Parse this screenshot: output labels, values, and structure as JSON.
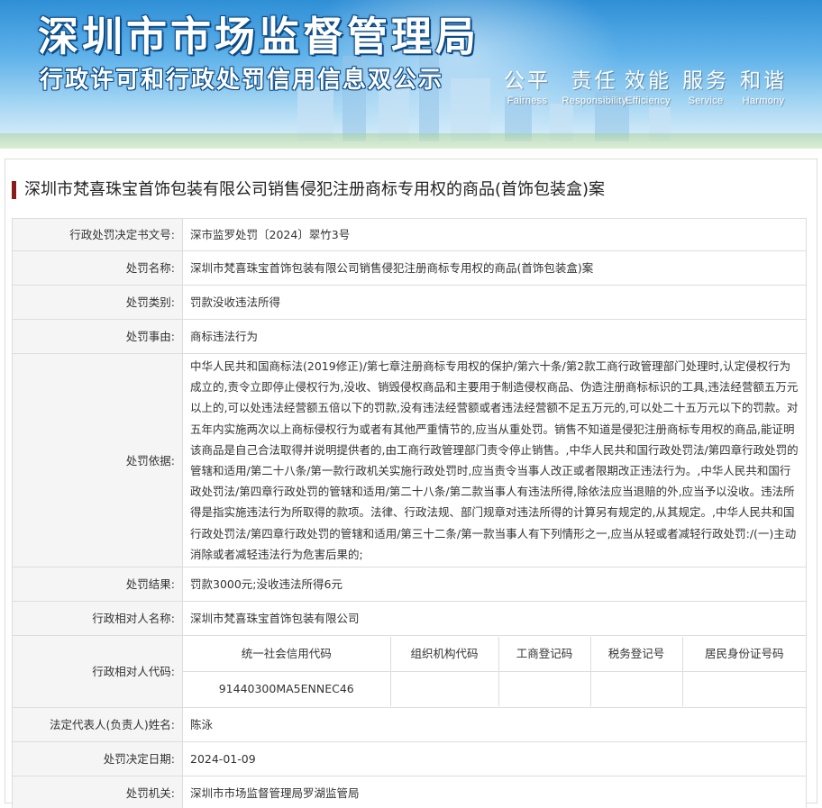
{
  "banner": {
    "title": "深圳市市场监督管理局",
    "subtitle": "行政许可和行政处罚信用信息双公示",
    "slogans": [
      {
        "cn": "公平",
        "en": "Fairness"
      },
      {
        "cn": "责任",
        "en": "Responsibility"
      },
      {
        "cn": "效能",
        "en": "Efficiency"
      },
      {
        "cn": "服务",
        "en": "Service"
      },
      {
        "cn": "和谐",
        "en": "Harmony"
      }
    ]
  },
  "case_title": "深圳市梵喜珠宝首饰包装有限公司销售侵犯注册商标专用权的商品(首饰包装盒)案",
  "details": {
    "decision_no": {
      "label": "行政处罚决定书文号:",
      "value": "深市监罗处罚〔2024〕翠竹3号"
    },
    "penalty_name": {
      "label": "处罚名称:",
      "value": "深圳市梵喜珠宝首饰包装有限公司销售侵犯注册商标专用权的商品(首饰包装盒)案"
    },
    "category": {
      "label": "处罚类别:",
      "value": "罚款没收违法所得"
    },
    "reason": {
      "label": "处罚事由:",
      "value": "商标违法行为"
    },
    "basis": {
      "label": "处罚依据:",
      "value": "中华人民共和国商标法(2019修正)/第七章注册商标专用权的保护/第六十条/第2款工商行政管理部门处理时,认定侵权行为成立的,责令立即停止侵权行为,没收、销毁侵权商品和主要用于制造侵权商品、伪造注册商标标识的工具,违法经营额五万元以上的,可以处违法经营额五倍以下的罚款,没有违法经营额或者违法经营额不足五万元的,可以处二十五万元以下的罚款。对五年内实施两次以上商标侵权行为或者有其他严重情节的,应当从重处罚。销售不知道是侵犯注册商标专用权的商品,能证明该商品是自己合法取得并说明提供者的,由工商行政管理部门责令停止销售。,中华人民共和国行政处罚法/第四章行政处罚的管辖和适用/第二十八条/第一款行政机关实施行政处罚时,应当责令当事人改正或者限期改正违法行为。,中华人民共和国行政处罚法/第四章行政处罚的管辖和适用/第二十八条/第二款当事人有违法所得,除依法应当退赔的外,应当予以没收。违法所得是指实施违法行为所取得的款项。法律、行政法规、部门规章对违法所得的计算另有规定的,从其规定。,中华人民共和国行政处罚法/第四章行政处罚的管辖和适用/第三十二条/第一款当事人有下列情形之一,应当从轻或者减轻行政处罚:/(一)主动消除或者减轻违法行为危害后果的;"
    },
    "result": {
      "label": "处罚结果:",
      "value": "罚款3000元;没收违法所得6元"
    },
    "party_name": {
      "label": "行政相对人名称:",
      "value": "深圳市梵喜珠宝首饰包装有限公司"
    },
    "party_code": {
      "label": "行政相对人代码:",
      "headers": [
        "统一社会信用代码",
        "组织机构代码",
        "工商登记码",
        "税务登记号",
        "居民身份证号码"
      ],
      "values": [
        "91440300MA5ENNEC46",
        "",
        "",
        "",
        ""
      ]
    },
    "legal_rep": {
      "label": "法定代表人(负责人)姓名:",
      "value": "陈泳"
    },
    "decision_date": {
      "label": "处罚决定日期:",
      "value": "2024-01-09"
    },
    "authority": {
      "label": "处罚机关:",
      "value": "深圳市市场监督管理局罗湖监管局"
    }
  }
}
